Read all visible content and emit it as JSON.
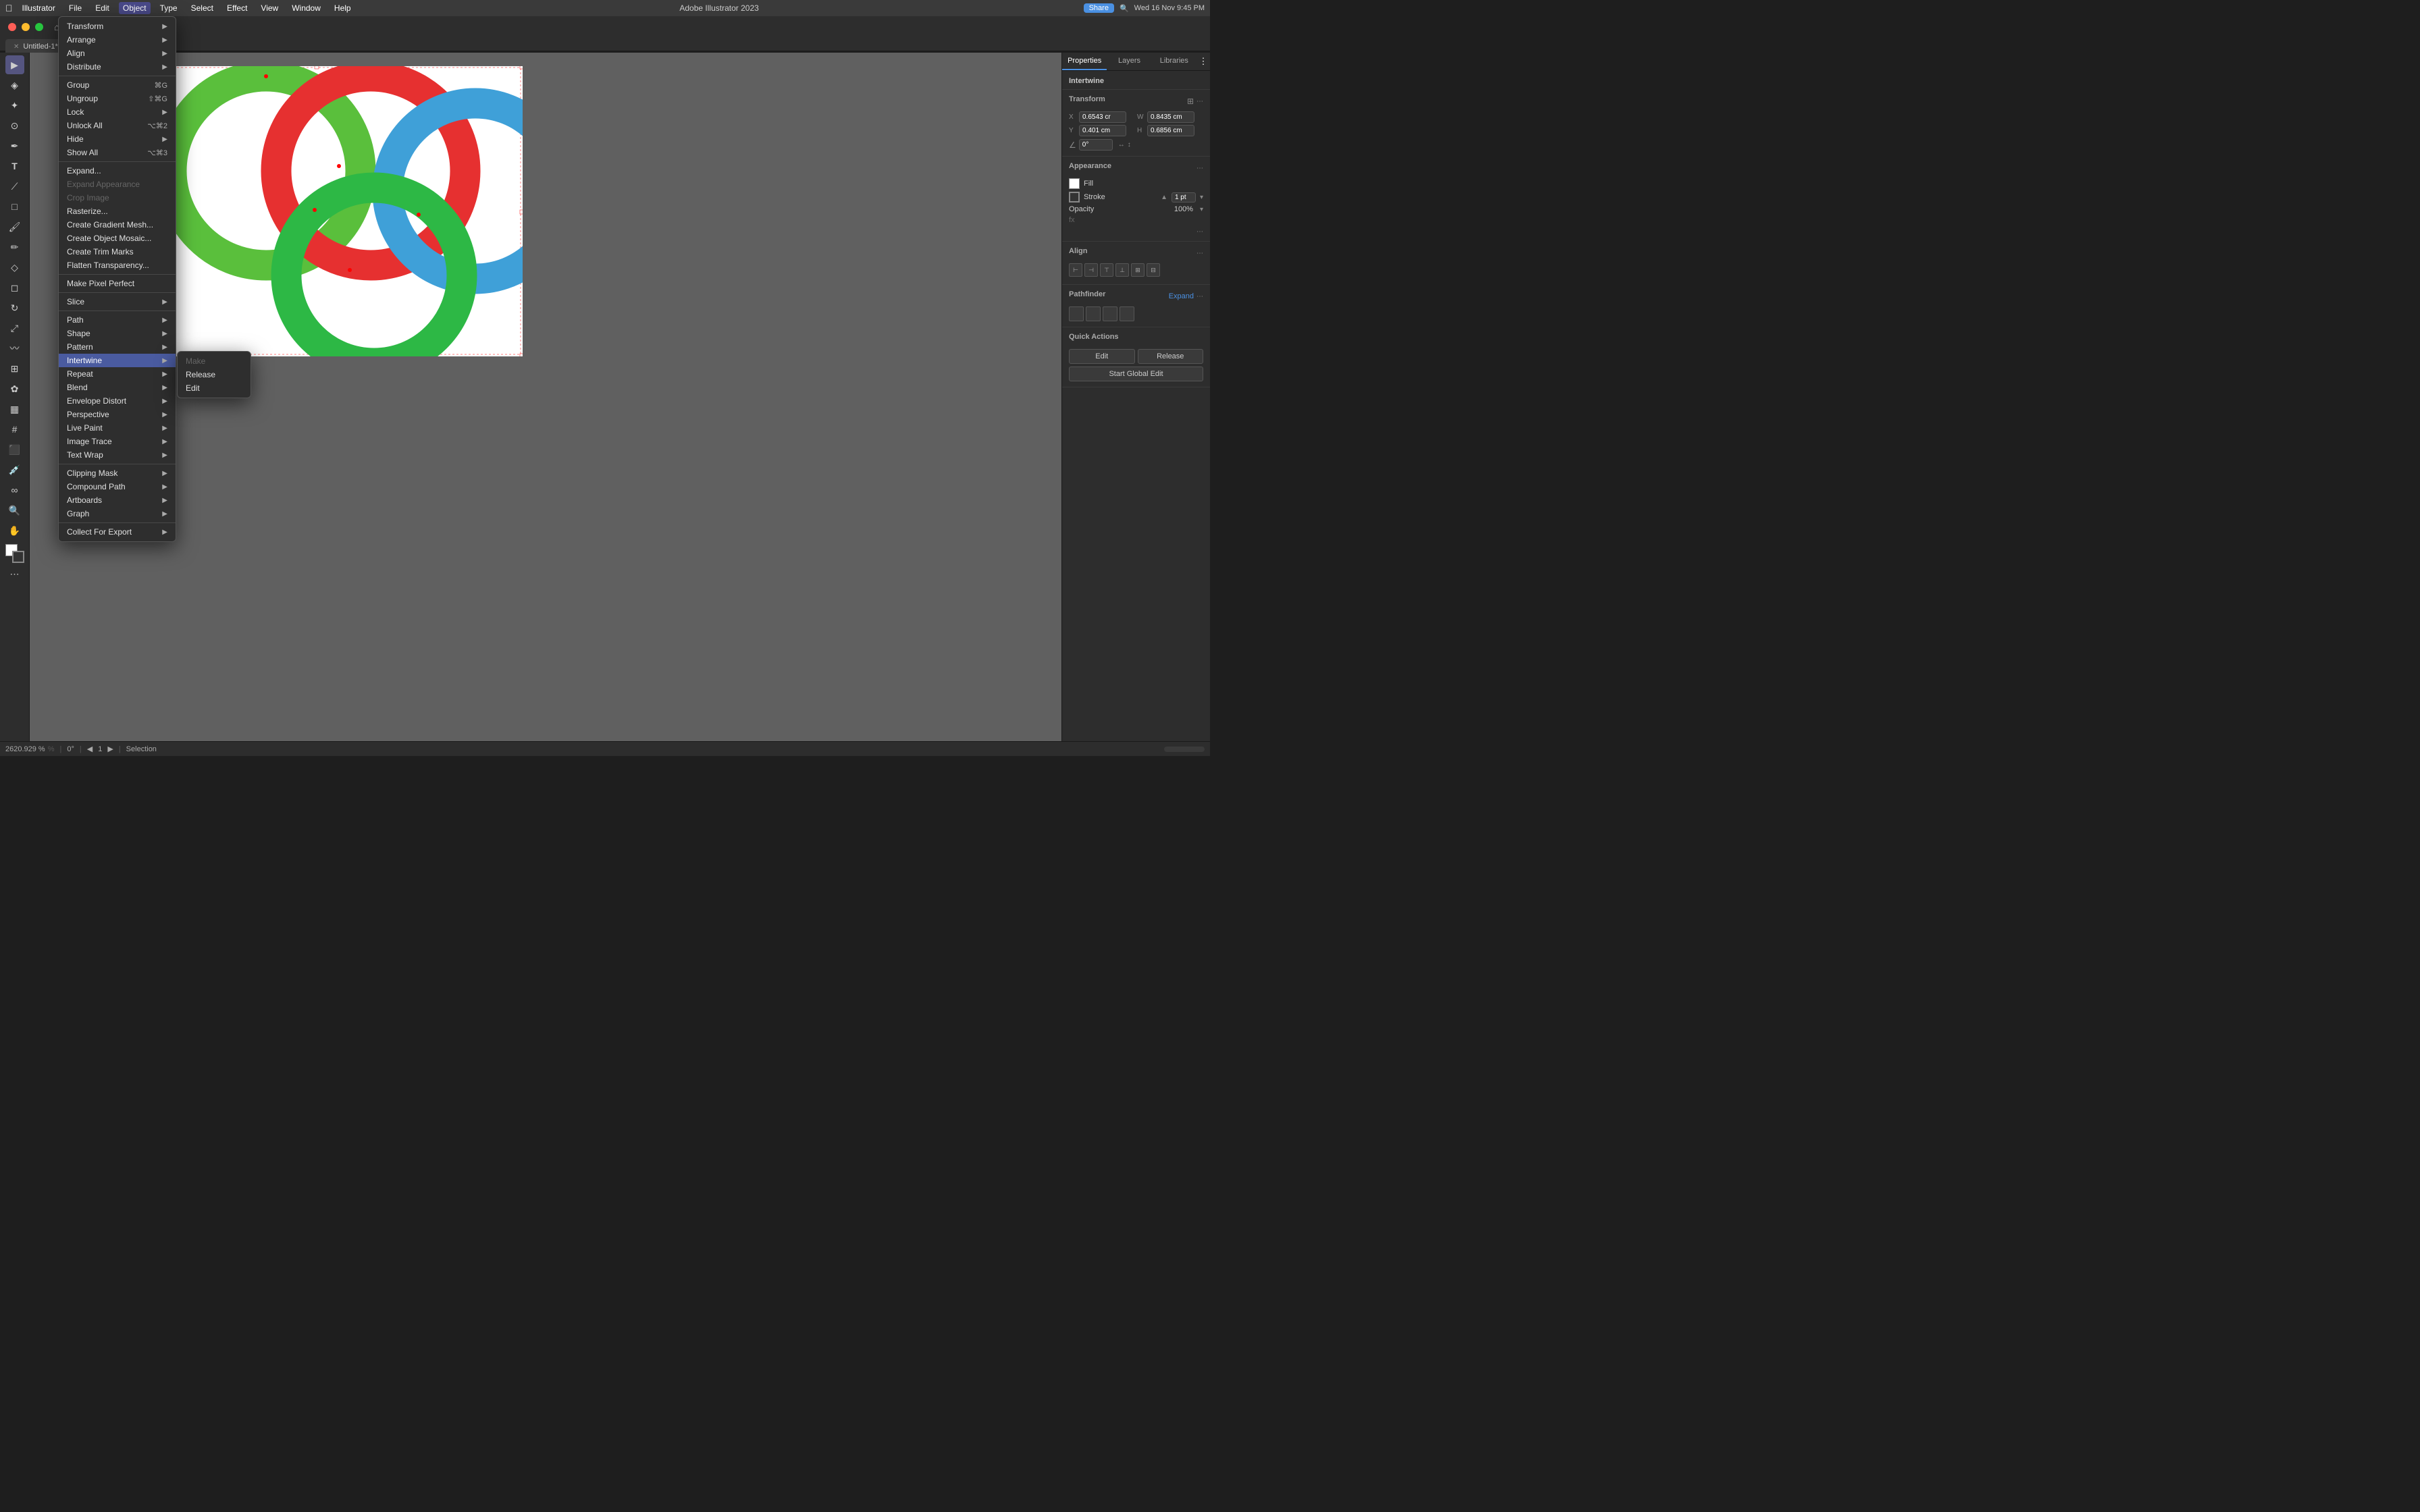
{
  "app": {
    "title": "Adobe Illustrator 2023",
    "window_title": "Untitled-1* @ 2620.92 % (C...",
    "zoom": "2620.92%",
    "rotation": "0°",
    "page": "1",
    "tool": "Selection",
    "datetime": "Wed 16 Nov  9:45 PM"
  },
  "menu_bar": {
    "items": [
      "Illustrator",
      "File",
      "Edit",
      "Object",
      "Type",
      "Select",
      "Effect",
      "View",
      "Window",
      "Help"
    ]
  },
  "object_menu": {
    "items": [
      {
        "label": "Transform",
        "hasArrow": true
      },
      {
        "label": "Arrange",
        "hasArrow": true
      },
      {
        "label": "Align",
        "hasArrow": true
      },
      {
        "label": "Distribute",
        "hasArrow": true
      },
      {
        "label": "separator"
      },
      {
        "label": "Group",
        "shortcut": "⌘G"
      },
      {
        "label": "Ungroup",
        "shortcut": "⇧⌘G"
      },
      {
        "label": "Lock",
        "hasArrow": true
      },
      {
        "label": "Unlock All",
        "shortcut": "⌥⌘2"
      },
      {
        "label": "Hide",
        "hasArrow": true
      },
      {
        "label": "Show All",
        "shortcut": "⌥⌘3"
      },
      {
        "label": "separator"
      },
      {
        "label": "Expand..."
      },
      {
        "label": "Expand Appearance",
        "disabled": true
      },
      {
        "label": "Crop Image",
        "disabled": true
      },
      {
        "label": "Rasterize..."
      },
      {
        "label": "Create Gradient Mesh..."
      },
      {
        "label": "Create Object Mosaic..."
      },
      {
        "label": "Create Trim Marks"
      },
      {
        "label": "Flatten Transparency..."
      },
      {
        "label": "separator"
      },
      {
        "label": "Make Pixel Perfect"
      },
      {
        "label": "separator"
      },
      {
        "label": "Slice",
        "hasArrow": true
      },
      {
        "label": "separator"
      },
      {
        "label": "Path",
        "hasArrow": true
      },
      {
        "label": "Shape",
        "hasArrow": true
      },
      {
        "label": "Pattern",
        "hasArrow": true
      },
      {
        "label": "Intertwine",
        "hasArrow": true,
        "highlighted": true
      },
      {
        "label": "Repeat",
        "hasArrow": true
      },
      {
        "label": "Blend",
        "hasArrow": true
      },
      {
        "label": "Envelope Distort",
        "hasArrow": true
      },
      {
        "label": "Perspective",
        "hasArrow": true
      },
      {
        "label": "Live Paint",
        "hasArrow": true
      },
      {
        "label": "Image Trace",
        "hasArrow": true
      },
      {
        "label": "Text Wrap",
        "hasArrow": true
      },
      {
        "label": "separator"
      },
      {
        "label": "Clipping Mask",
        "hasArrow": true
      },
      {
        "label": "Compound Path",
        "hasArrow": true
      },
      {
        "label": "Artboards",
        "hasArrow": true
      },
      {
        "label": "Graph",
        "hasArrow": true
      },
      {
        "label": "separator"
      },
      {
        "label": "Collect For Export",
        "hasArrow": true
      }
    ]
  },
  "intertwine_submenu": {
    "items": [
      {
        "label": "Make",
        "disabled": true
      },
      {
        "label": "Release"
      },
      {
        "label": "Edit"
      }
    ]
  },
  "properties": {
    "title": "Intertwine",
    "tabs": [
      "Properties",
      "Layers",
      "Libraries"
    ],
    "transform": {
      "x_label": "X",
      "x_value": "0.6543 cr",
      "y_label": "Y",
      "y_value": "0.401 cm",
      "w_label": "W",
      "w_value": "0.8435 cm",
      "h_label": "H",
      "h_value": "0.6856 cm",
      "angle": "0°"
    },
    "appearance": {
      "fill_label": "Fill",
      "stroke_label": "Stroke",
      "stroke_value": "1 pt",
      "opacity_label": "Opacity",
      "opacity_value": "100%"
    },
    "align_title": "Align",
    "pathfinder_title": "Pathfinder",
    "pathfinder_expand": "Expand",
    "quick_actions_title": "Quick Actions",
    "edit_btn": "Edit",
    "release_btn": "Release",
    "global_edit_btn": "Start Global Edit"
  },
  "status_bar": {
    "zoom": "2620.929 %",
    "rotation": "0°",
    "page": "1",
    "tool": "Selection"
  }
}
